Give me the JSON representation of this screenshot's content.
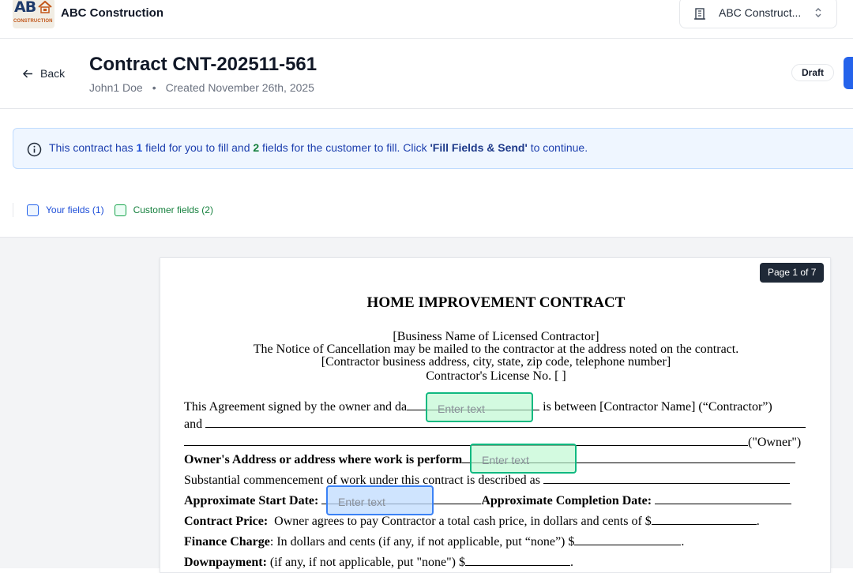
{
  "app": {
    "logo_text": "AB",
    "logo_sub": "CONSTRUCTION",
    "company_name": "ABC Construction",
    "org_selector": "ABC Construct..."
  },
  "header": {
    "back_label": "Back",
    "title": "Contract CNT-202511-561",
    "author": "John1 Doe",
    "separator": "•",
    "created": "Created November 26th, 2025",
    "status": "Draft"
  },
  "banner": {
    "pre": "This contract has ",
    "your_count": "1",
    "mid1": " field for you to fill and ",
    "customer_count": "2",
    "mid2": " fields for the customer to fill. Click ",
    "action": "'Fill Fields & Send'",
    "post": " to continue."
  },
  "legend": {
    "your_fields": "Your fields (1)",
    "customer_fields": "Customer fields (2)"
  },
  "document": {
    "page_indicator": "Page 1 of 7",
    "title": "HOME IMPROVEMENT CONTRACT",
    "line1": "[Business Name of Licensed Contractor]",
    "line2": "The Notice of Cancellation may be mailed to the contractor at the address noted on the contract.",
    "line3": "[Contractor business address, city, state, zip code, telephone number]",
    "line4": "Contractor's License No.  [          ]",
    "agreement_a": "This  Agreement  signed  by  the owner and  da",
    "agreement_b": "is between [Contractor Name] (“Contractor”)",
    "and": "and",
    "owner": "(\"Owner\")",
    "owners_address": "Owner's Address or address where work is perform",
    "substantial": "Substantial commencement of work under this contract is described as",
    "start_date": "Approximate Start Date:",
    "completion_date": "Approximate Completion Date:",
    "contract_price_label": "Contract Price:",
    "contract_price_text": "Owner agrees to pay Contractor a total cash price, in dollars and cents of $",
    "finance_label": "Finance Charge",
    "finance_text": ": In dollars and cents (if any, if not applicable, put “none”) $",
    "downpayment_label": "Downpayment:",
    "downpayment_text": "(if any, if not applicable, put \"none\") $"
  },
  "fields": {
    "customer_1": "Enter text",
    "customer_2": "Enter text",
    "yours_1": "Enter text"
  },
  "colors": {
    "your_field": "#3b82f6",
    "customer_field": "#10b981",
    "primary": "#2563eb",
    "page_badge": "#1f2937"
  }
}
